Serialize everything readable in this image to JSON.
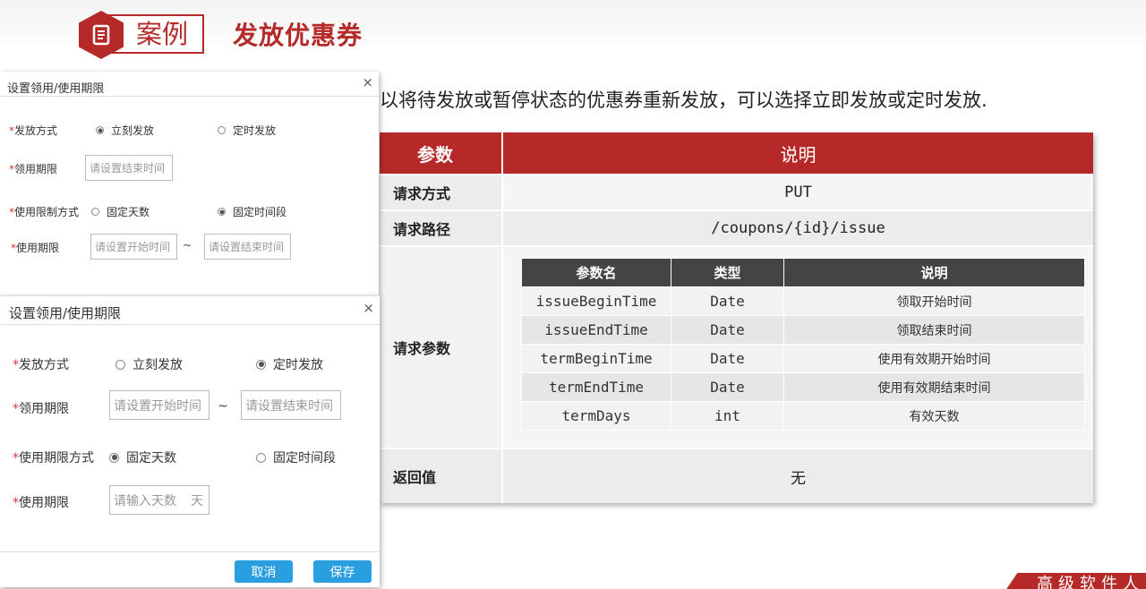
{
  "slide": {
    "badge_label": "案例",
    "title": "发放优惠券",
    "description": "以将待发放或暂停状态的优惠券重新发放，可以选择立即发放或定时发放."
  },
  "api_table": {
    "header": {
      "param": "参数",
      "desc": "说明"
    },
    "method": {
      "label": "请求方式",
      "value": "PUT"
    },
    "path": {
      "label": "请求路径",
      "value": "/coupons/{id}/issue"
    },
    "params_label": "请求参数",
    "params_header": {
      "name": "参数名",
      "type": "类型",
      "desc": "说明"
    },
    "params": [
      {
        "name": "issueBeginTime",
        "type": "Date",
        "desc": "领取开始时间"
      },
      {
        "name": "issueEndTime",
        "type": "Date",
        "desc": "领取结束时间"
      },
      {
        "name": "termBeginTime",
        "type": "Date",
        "desc": "使用有效期开始时间"
      },
      {
        "name": "termEndTime",
        "type": "Date",
        "desc": "使用有效期结束时间"
      },
      {
        "name": "termDays",
        "type": "int",
        "desc": "有效天数"
      }
    ],
    "return": {
      "label": "返回值",
      "value": "无"
    }
  },
  "dialog1": {
    "title": "设置领用/使用期限",
    "close": "×",
    "issue_mode_label": "发放方式",
    "issue_now": "立刻发放",
    "issue_scheduled": "定时发放",
    "claim_period_label": "领用期限",
    "claim_end_placeholder": "请设置结束时间",
    "limit_mode_label": "使用限制方式",
    "fixed_days": "固定天数",
    "fixed_period": "固定时间段",
    "use_period_label": "使用期限",
    "use_start_placeholder": "请设置开始时间",
    "tilde": "~",
    "use_end_placeholder": "请设置结束时间"
  },
  "dialog2": {
    "title": "设置领用/使用期限",
    "close": "×",
    "issue_mode_label": "发放方式",
    "issue_now": "立刻发放",
    "issue_scheduled": "定时发放",
    "claim_period_label": "领用期限",
    "claim_start_placeholder": "请设置开始时间",
    "tilde": "~",
    "claim_end_placeholder": "请设置结束时间",
    "limit_mode_label": "使用期限方式",
    "fixed_days": "固定天数",
    "fixed_period": "固定时间段",
    "use_period_label": "使用期限",
    "days_placeholder": "请输入天数",
    "days_unit": "天",
    "cancel_label": "取消",
    "save_label": "保存"
  },
  "footer": {
    "brand": "高级软件人才"
  },
  "colors": {
    "brand_red": "#b52a28",
    "button_blue": "#2a9fe0",
    "param_header": "#444444"
  }
}
